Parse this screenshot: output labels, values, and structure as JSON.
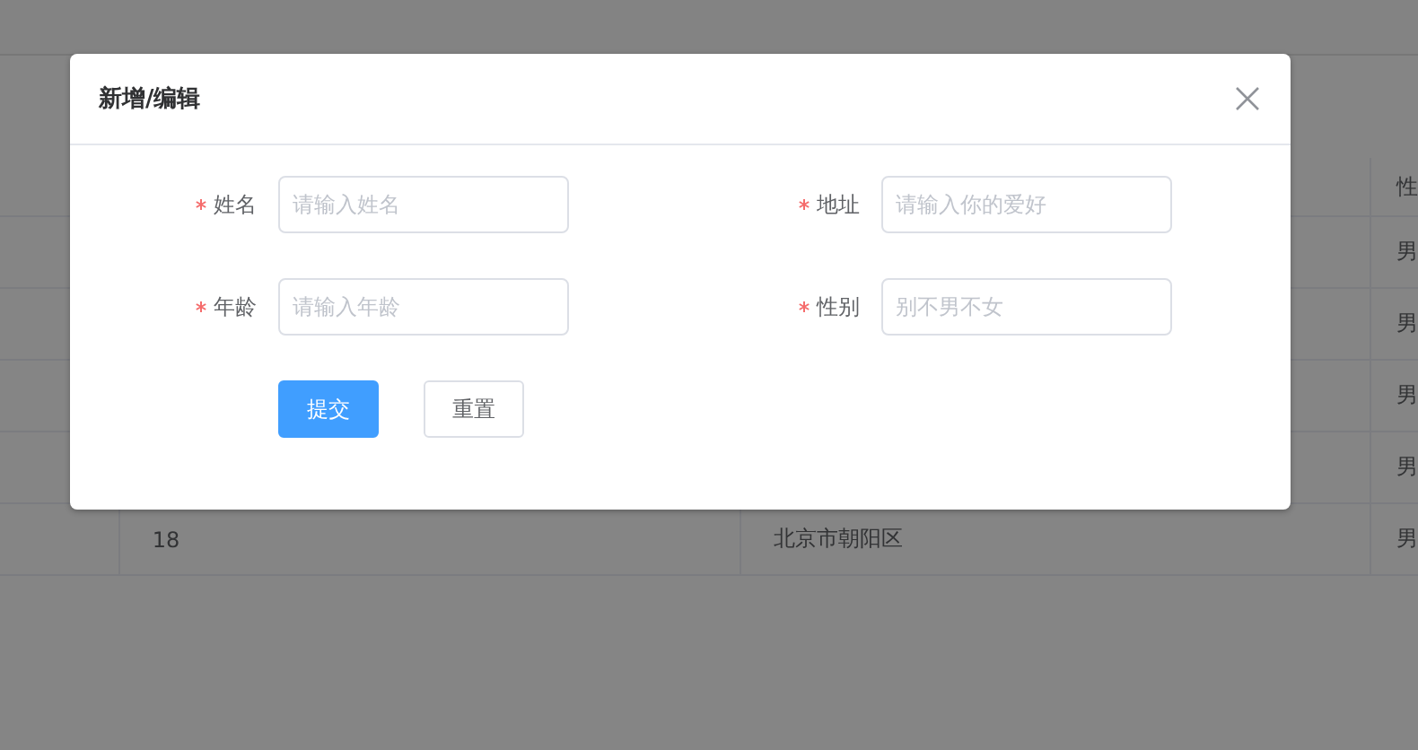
{
  "table": {
    "header": {
      "column_4": "性"
    },
    "rows": [
      {
        "column_4": "男"
      },
      {
        "column_4": "男"
      },
      {
        "column_4": "男"
      },
      {
        "column_4": "男"
      },
      {
        "column_2": "18",
        "column_3": "北京市朝阳区",
        "column_4": "男"
      }
    ]
  },
  "dialog": {
    "title": "新增/编辑",
    "fields": [
      {
        "label": "姓名",
        "required": true,
        "placeholder": "请输入姓名"
      },
      {
        "label": "地址",
        "required": true,
        "placeholder": "请输入你的爱好"
      },
      {
        "label": "年龄",
        "required": true,
        "placeholder": "请输入年龄"
      },
      {
        "label": "性别",
        "required": true,
        "placeholder": "别不男不女"
      }
    ],
    "buttons": [
      {
        "label": "提交",
        "kind": "primary"
      },
      {
        "label": "重置",
        "kind": "default"
      }
    ]
  }
}
